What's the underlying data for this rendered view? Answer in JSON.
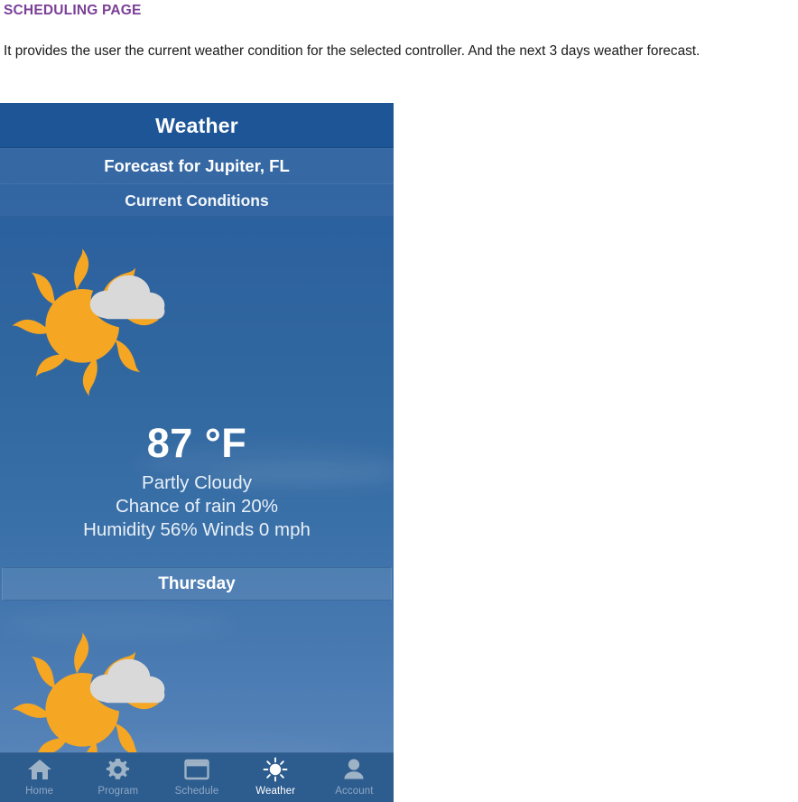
{
  "document": {
    "heading": "SCHEDULING PAGE",
    "body": "It provides the user the current weather condition for the selected controller. And the next 3 days weather forecast."
  },
  "app": {
    "title_bar": {
      "title": "Weather"
    },
    "forecast_band": {
      "label": "Forecast for Jupiter, FL"
    },
    "current_band": {
      "label": "Current Conditions"
    },
    "current": {
      "icon": "partly-cloudy-icon",
      "temperature": "87 °F",
      "condition": "Partly Cloudy",
      "chance_of_rain": "Chance of rain 20%",
      "humidity_winds": "Humidity 56%  Winds 0 mph"
    },
    "days": [
      {
        "name": "Thursday",
        "icon": "partly-cloudy-icon"
      }
    ],
    "nav": {
      "active": "Weather",
      "items": [
        {
          "label": "Home",
          "icon": "home-icon"
        },
        {
          "label": "Program",
          "icon": "gear-icon"
        },
        {
          "label": "Schedule",
          "icon": "calendar-icon"
        },
        {
          "label": "Weather",
          "icon": "sun-icon"
        },
        {
          "label": "Account",
          "icon": "person-icon"
        }
      ]
    }
  },
  "colors": {
    "heading_purple": "#7B3F98",
    "title_bar_blue": "#1D5596",
    "nav_bar_blue": "#2D5C8F",
    "sky_top": "#2A5F9D",
    "sky_bottom": "#6690C0",
    "sun_orange": "#F5A623",
    "cloud_gray": "#D8D8D8",
    "nav_icon_inactive": "#8FA9C4",
    "nav_icon_active": "#FFFFFF"
  }
}
